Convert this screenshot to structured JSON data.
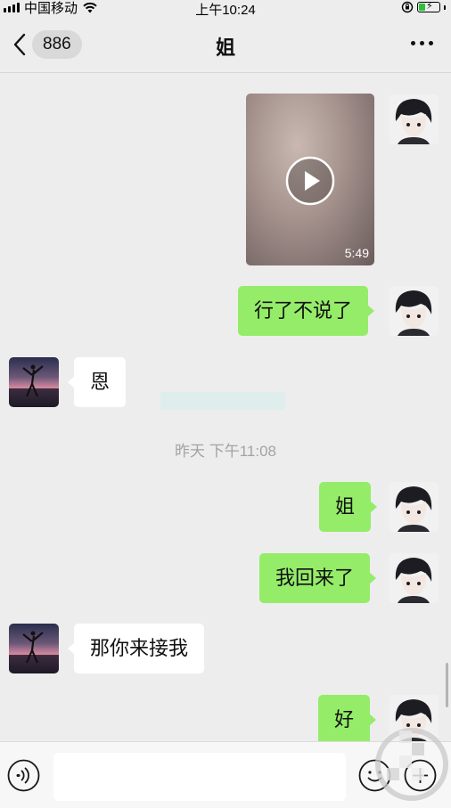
{
  "status_bar": {
    "carrier": "中国移动",
    "time": "上午10:24",
    "icons": [
      "signal-icon",
      "wifi-icon",
      "orientation-lock-icon",
      "battery-charging-icon"
    ]
  },
  "nav": {
    "unread_count": "886",
    "title": "姐",
    "icons": [
      "chevron-left-icon",
      "more-icon"
    ]
  },
  "messages": {
    "video": {
      "duration": "5:49"
    },
    "m1": "行了不说了",
    "m2": "恩",
    "timestamp": "昨天 下午11:08",
    "m3": "姐",
    "m4": "我回来了",
    "m5": "那你来接我",
    "m6": "好"
  },
  "input_bar": {
    "value": "",
    "icons": [
      "voice-icon",
      "emoji-icon",
      "plus-icon"
    ]
  },
  "colors": {
    "background": "#ededed",
    "my_bubble": "#95ec69",
    "their_bubble": "#ffffff",
    "timestamp_text": "#a3a3a3"
  }
}
